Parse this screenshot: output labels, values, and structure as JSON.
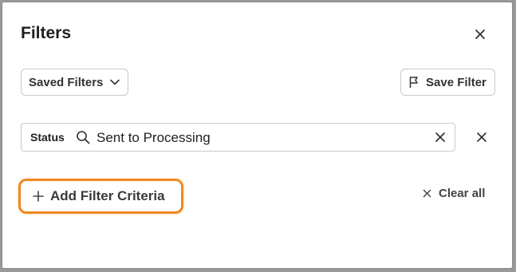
{
  "dialog": {
    "title": "Filters",
    "close_icon": "close-icon"
  },
  "toolbar": {
    "saved_filters_label": "Saved Filters",
    "saved_filters_icon": "chevron-down-icon",
    "save_filter_label": "Save Filter",
    "save_filter_icon": "flag-icon"
  },
  "filter_row": {
    "field_label": "Status",
    "search_icon": "search-icon",
    "value": "Sent to Processing",
    "clear_icon": "close-icon",
    "remove_icon": "close-icon"
  },
  "actions": {
    "add_criteria_label": "Add Filter Criteria",
    "add_icon": "plus-icon",
    "clear_all_label": "Clear all",
    "clear_all_icon": "close-icon"
  },
  "colors": {
    "highlight": "#f0891e",
    "text": "#333333",
    "border": "#c9c9c9"
  }
}
